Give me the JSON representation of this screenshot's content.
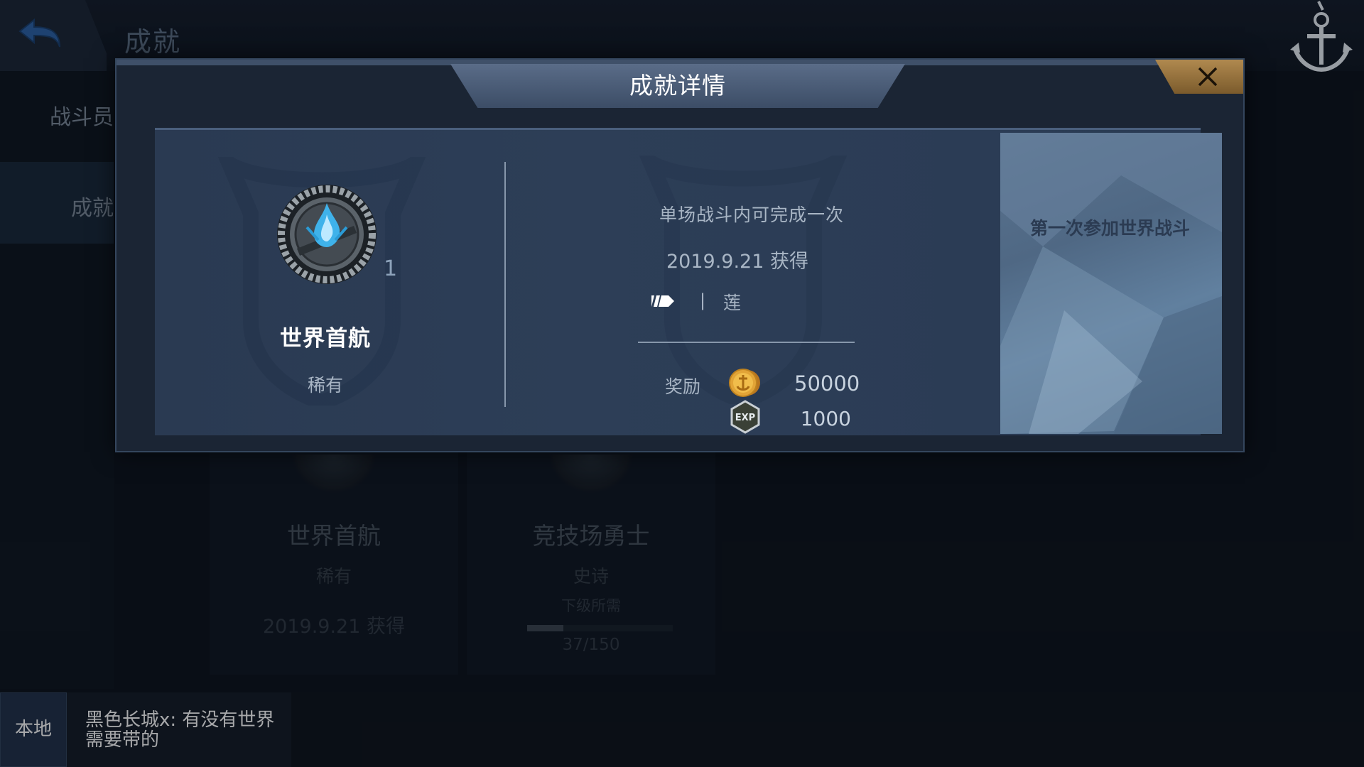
{
  "header": {
    "title": "成就"
  },
  "sidebar": {
    "items": [
      {
        "label": "战斗员"
      },
      {
        "label": "成就"
      }
    ]
  },
  "cards": [
    {
      "name": "世界首航",
      "rarity": "稀有",
      "date": "2019.9.21 获得"
    },
    {
      "name": "竞技场勇士",
      "rarity": "史诗",
      "sub": "下级所需",
      "progress": "37/150",
      "progress_value": 0.25
    }
  ],
  "chat": {
    "tab": "本地",
    "message": "黑色长城x: 有没有世界需要带的"
  },
  "modal": {
    "title": "成就详情",
    "achievement": {
      "name": "世界首航",
      "rarity": "稀有",
      "level": "1"
    },
    "condition": "单场战斗内可完成一次",
    "date": "2019.9.21 获得",
    "tag_separator": "|",
    "tag_name": "莲",
    "reward_label": "奖励",
    "rewards": [
      {
        "icon": "gold-coin-icon",
        "value": "50000"
      },
      {
        "icon": "exp-icon",
        "value": "1000"
      }
    ],
    "description": "第一次参加世界战斗"
  },
  "colors": {
    "modal_bg": "#1b2534",
    "panel_bg": "#2d3e57",
    "close_button": "#9b7640",
    "title_tab": "#4b5c77",
    "coin_gold": "#e2a437"
  }
}
